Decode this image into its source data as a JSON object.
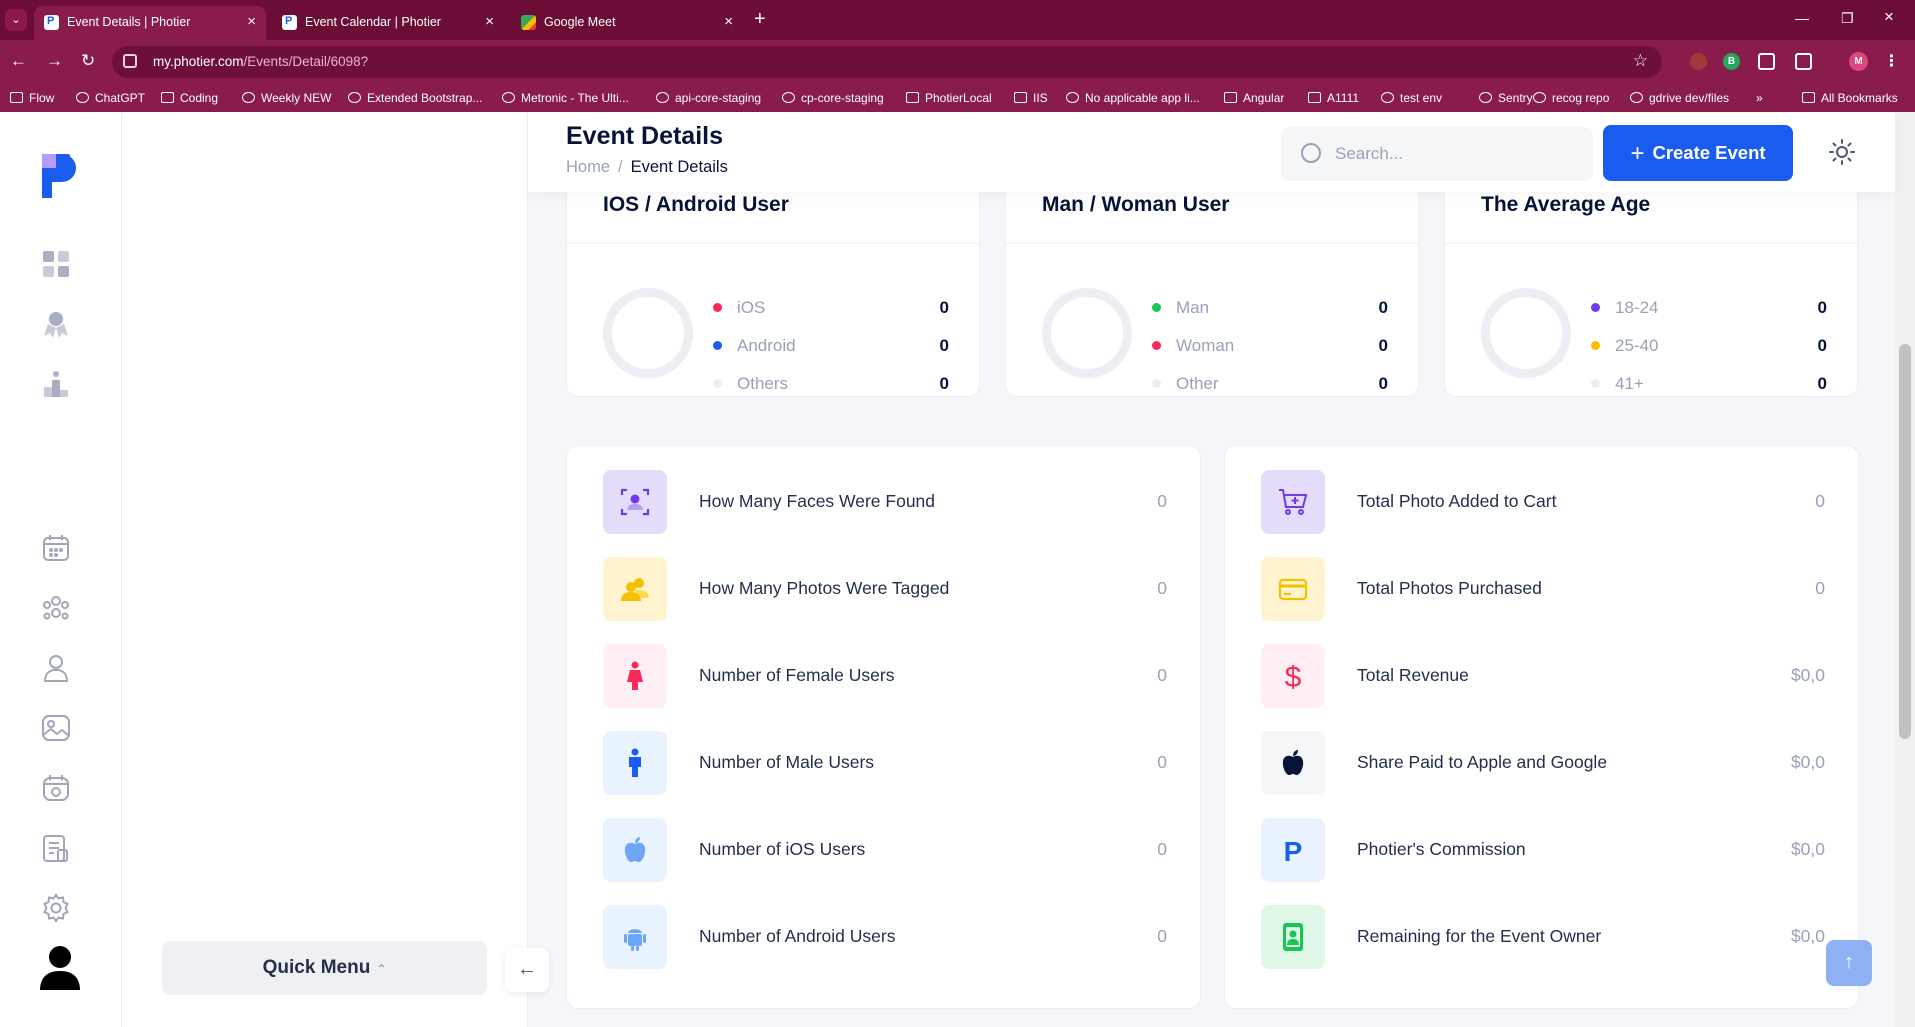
{
  "browser": {
    "tabs": [
      {
        "title": "Event Details | Photier",
        "active": true
      },
      {
        "title": "Event Calendar | Photier",
        "active": false
      },
      {
        "title": "Google Meet",
        "active": false
      }
    ],
    "url_host": "my.photier.com",
    "url_path": "/Events/Detail/6098?",
    "bookmarks": [
      "Flow",
      "ChatGPT",
      "Coding",
      "Weekly NEW",
      "Extended Bootstrap...",
      "Metronic - The Ulti...",
      "api-core-staging",
      "cp-core-staging",
      "PhotierLocal",
      "IIS",
      "No applicable app li...",
      "Angular",
      "A1111",
      "test env",
      "Sentry",
      "recog repo",
      "gdrive dev/files",
      "All Bookmarks"
    ],
    "profile_initial": "M",
    "ext_badge": "B"
  },
  "header": {
    "title": "Event Details",
    "breadcrumb": {
      "home": "Home",
      "separator": "/",
      "current": "Event Details"
    },
    "search_placeholder": "Search...",
    "create_button": "Create Event"
  },
  "sidebar": {
    "icons": [
      "dashboard-icon",
      "award-icon",
      "podium-icon",
      "calendar-icon",
      "people-icon",
      "user-icon",
      "image-icon",
      "calendar-camera-icon",
      "report-icon",
      "gear-icon",
      "avatar-icon"
    ]
  },
  "quick_menu": {
    "label": "Quick Menu"
  },
  "stats": [
    {
      "title": "IOS / Android User",
      "items": [
        {
          "label": "iOS",
          "value": "0",
          "color": "#f8285a"
        },
        {
          "label": "Android",
          "value": "0",
          "color": "#1b5cf0"
        },
        {
          "label": "Others",
          "value": "0",
          "color": "#eceef3"
        }
      ]
    },
    {
      "title": "Man / Woman User",
      "items": [
        {
          "label": "Man",
          "value": "0",
          "color": "#17c653"
        },
        {
          "label": "Woman",
          "value": "0",
          "color": "#f8285a"
        },
        {
          "label": "Other",
          "value": "0",
          "color": "#eceef3"
        }
      ]
    },
    {
      "title": "The Average Age",
      "items": [
        {
          "label": "18-24",
          "value": "0",
          "color": "#7239ea"
        },
        {
          "label": "25-40",
          "value": "0",
          "color": "#f6c000"
        },
        {
          "label": "41+",
          "value": "0",
          "color": "#eceef3"
        }
      ]
    }
  ],
  "left_list": [
    {
      "label": "How Many Faces Were Found",
      "value": "0",
      "icon": "face-scan-icon",
      "bg": "#e5dcfb",
      "fg": "#7239ea"
    },
    {
      "label": "How Many Photos Were Tagged",
      "value": "0",
      "icon": "users-tag-icon",
      "bg": "#fff4cf",
      "fg": "#f6c000"
    },
    {
      "label": "Number of Female Users",
      "value": "0",
      "icon": "female-icon",
      "bg": "#ffeef3",
      "fg": "#f8285a"
    },
    {
      "label": "Number of Male Users",
      "value": "0",
      "icon": "male-icon",
      "bg": "#e9f3ff",
      "fg": "#1b5cf0"
    },
    {
      "label": "Number of iOS Users",
      "value": "0",
      "icon": "apple-icon",
      "bg": "#e9f3ff",
      "fg": "#6ea5f5"
    },
    {
      "label": "Number of Android Users",
      "value": "0",
      "icon": "android-icon",
      "bg": "#e9f3ff",
      "fg": "#6ea5f5"
    }
  ],
  "right_list": [
    {
      "label": "Total Photo Added to Cart",
      "value": "0",
      "icon": "cart-icon",
      "bg": "#e5dcfb",
      "fg": "#7239ea"
    },
    {
      "label": "Total Photos Purchased",
      "value": "0",
      "icon": "credit-card-icon",
      "bg": "#fff4cf",
      "fg": "#f6c000"
    },
    {
      "label": "Total Revenue",
      "value": "$0,0",
      "icon": "dollar-icon",
      "bg": "#ffeef3",
      "fg": "#f8285a"
    },
    {
      "label": "Share Paid to Apple and Google",
      "value": "$0,0",
      "icon": "apple-icon",
      "bg": "#f5f6f8",
      "fg": "#071437"
    },
    {
      "label": "Photier's Commission",
      "value": "$0,0",
      "icon": "photier-p-icon",
      "bg": "#e9f3ff",
      "fg": "#1b5cf0"
    },
    {
      "label": "Remaining for the Event Owner",
      "value": "$0,0",
      "icon": "id-badge-icon",
      "bg": "#dff7e6",
      "fg": "#17c653"
    }
  ]
}
